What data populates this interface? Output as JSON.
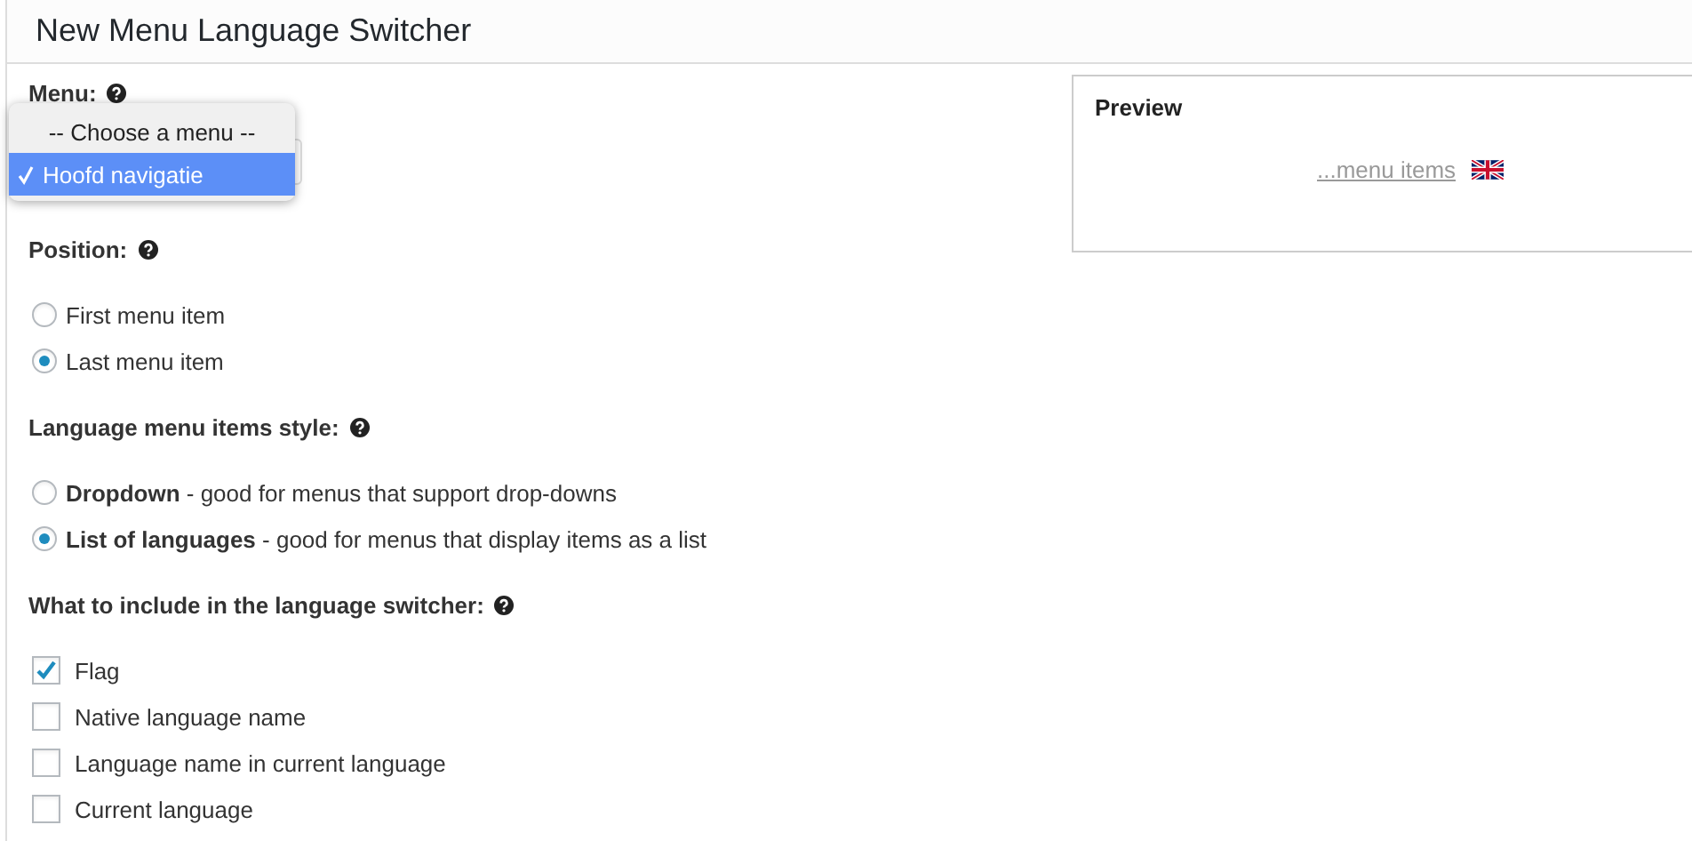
{
  "title": "New Menu Language Switcher",
  "menu": {
    "label": "Menu:",
    "options": [
      {
        "label": "-- Choose a menu --",
        "selected": false
      },
      {
        "label": "Hoofd navigatie",
        "selected": true
      }
    ]
  },
  "position": {
    "label": "Position:",
    "options": [
      {
        "label": "First menu item",
        "selected": false
      },
      {
        "label": "Last menu item",
        "selected": true
      }
    ]
  },
  "style": {
    "label": "Language menu items style:",
    "options": [
      {
        "label": "**Dropdown** - good for menus that support drop-downs",
        "selected": false
      },
      {
        "label": "**List of languages** - good for menus that display items as a list",
        "selected": true
      }
    ]
  },
  "include": {
    "label": "What to include in the language switcher:",
    "options": [
      {
        "label": "Flag",
        "checked": true
      },
      {
        "label": "Native language name",
        "checked": false
      },
      {
        "label": "Language name in current language",
        "checked": false
      },
      {
        "label": "Current language",
        "checked": false
      }
    ]
  },
  "preview": {
    "title": "Preview",
    "link": "...menu items"
  }
}
